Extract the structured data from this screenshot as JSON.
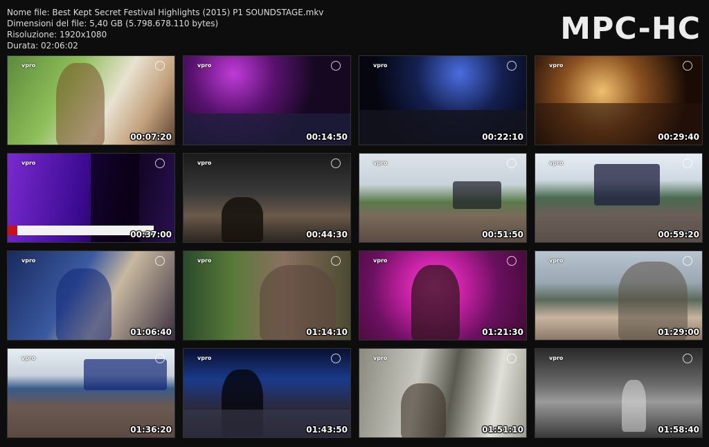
{
  "file_info": {
    "name": "Nome file: Best Kept Secret Festival Highlights (2015) P1 SOUNDSTAGE.mkv",
    "size": "Dimensioni del file: 5,40 GB (5.798.678.110 bytes)",
    "resolution": "Risoluzione: 1920x1080",
    "duration": "Durata: 02:06:02"
  },
  "app_logo": "MPC-HC",
  "thumbnails": [
    {
      "timestamp": "00:07:20",
      "channel": "vpro"
    },
    {
      "timestamp": "00:14:50",
      "channel": "vpro"
    },
    {
      "timestamp": "00:22:10",
      "channel": "vpro"
    },
    {
      "timestamp": "00:29:40",
      "channel": "vpro"
    },
    {
      "timestamp": "00:37:00",
      "channel": "vpro"
    },
    {
      "timestamp": "00:44:30",
      "channel": "vpro"
    },
    {
      "timestamp": "00:51:50",
      "channel": "vpro"
    },
    {
      "timestamp": "00:59:20",
      "channel": "vpro"
    },
    {
      "timestamp": "01:06:40",
      "channel": "vpro"
    },
    {
      "timestamp": "01:14:10",
      "channel": "vpro"
    },
    {
      "timestamp": "01:21:30",
      "channel": "vpro"
    },
    {
      "timestamp": "01:29:00",
      "channel": "vpro"
    },
    {
      "timestamp": "01:36:20",
      "channel": "vpro"
    },
    {
      "timestamp": "01:43:50",
      "channel": "vpro"
    },
    {
      "timestamp": "01:51:10",
      "channel": "vpro"
    },
    {
      "timestamp": "01:58:40",
      "channel": "vpro"
    }
  ],
  "colors": {
    "background": "#0d0d0d",
    "info_text": "#dcdcdc",
    "logo_text": "#ececec"
  }
}
